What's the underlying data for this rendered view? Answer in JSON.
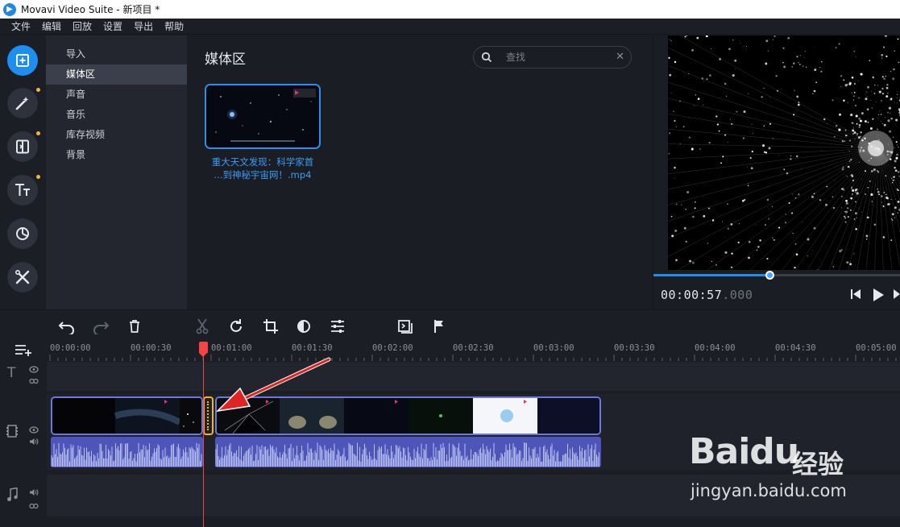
{
  "window": {
    "title": "Movavi Video Suite - 新项目 *"
  },
  "menu": [
    "文件",
    "编辑",
    "回放",
    "设置",
    "导出",
    "帮助"
  ],
  "rail": [
    {
      "icon": "add-media-icon",
      "active": true,
      "dot": false
    },
    {
      "icon": "magic-wand-icon",
      "active": false,
      "dot": true
    },
    {
      "icon": "transitions-icon",
      "active": false,
      "dot": true
    },
    {
      "icon": "titles-icon",
      "active": false,
      "dot": true
    },
    {
      "icon": "stickers-icon",
      "active": false,
      "dot": false
    },
    {
      "icon": "tools-icon",
      "active": false,
      "dot": false
    }
  ],
  "categories": [
    "导入",
    "媒体区",
    "声音",
    "音乐",
    "库存视频",
    "背景"
  ],
  "active_category": 1,
  "media": {
    "title": "媒体区",
    "search_placeholder": "查找",
    "clip": {
      "name_line1": "重大天文发现：科学家首",
      "name_line2": "...到神秘宇宙网！.mp4"
    }
  },
  "preview": {
    "timecode_main": "00:00:57",
    "timecode_ms": ".000",
    "progress": 0.47
  },
  "ruler": [
    "00:00:00",
    "00:00:30",
    "00:01:00",
    "00:01:30",
    "00:02:00",
    "00:02:30",
    "00:03:00",
    "00:03:30",
    "00:04:00",
    "00:04:30",
    "00:05:00"
  ],
  "watermark": {
    "logo": "Baidu",
    "cn": "经验",
    "url": "jingyan.baidu.com"
  },
  "colors": {
    "accent": "#1e8ef0",
    "clip_border": "#6f78d8",
    "audio": "#4d55b8",
    "playhead": "#f24646",
    "split": "#f5b522"
  }
}
